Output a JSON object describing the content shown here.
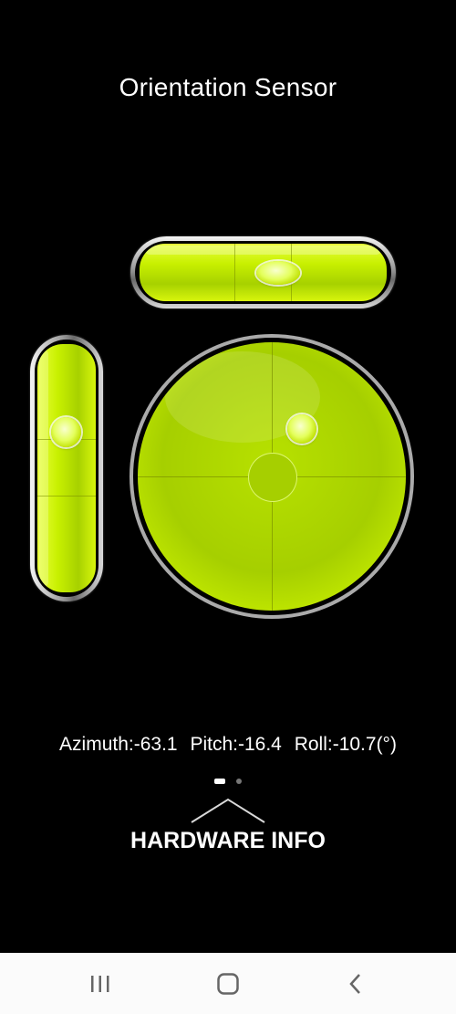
{
  "app": {
    "title": "Orientation Sensor"
  },
  "sensor": {
    "azimuth_label": "Azimuth:-63.1",
    "pitch_label": "Pitch:-16.4",
    "roll_label": "Roll:-10.7(°)"
  },
  "pager": {
    "page_count": 2,
    "active_page": 1
  },
  "footer": {
    "hardware_info_label": "HARDWARE INFO"
  },
  "navbar": {
    "recents_icon": "recents-icon",
    "home_icon": "home-icon",
    "back_icon": "back-icon"
  },
  "colors": {
    "background": "#000000",
    "level_fluid": "#b8e000",
    "text": "#ffffff"
  }
}
